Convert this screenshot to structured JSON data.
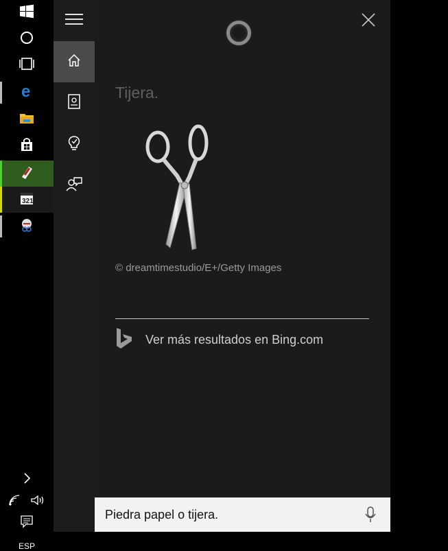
{
  "taskbar": {
    "language": "ESP"
  },
  "answer": {
    "title": "Tijera.",
    "image_credit": "© dreamtimestudio/E+/Getty Images",
    "bing_link": "Ver más resultados en Bing.com"
  },
  "search": {
    "value": "Piedra papel o tijera."
  },
  "colors": {
    "rail_active": "#4a4a4a",
    "panel_bg": "#1b1b1b",
    "search_bg": "#f2f2f2"
  }
}
